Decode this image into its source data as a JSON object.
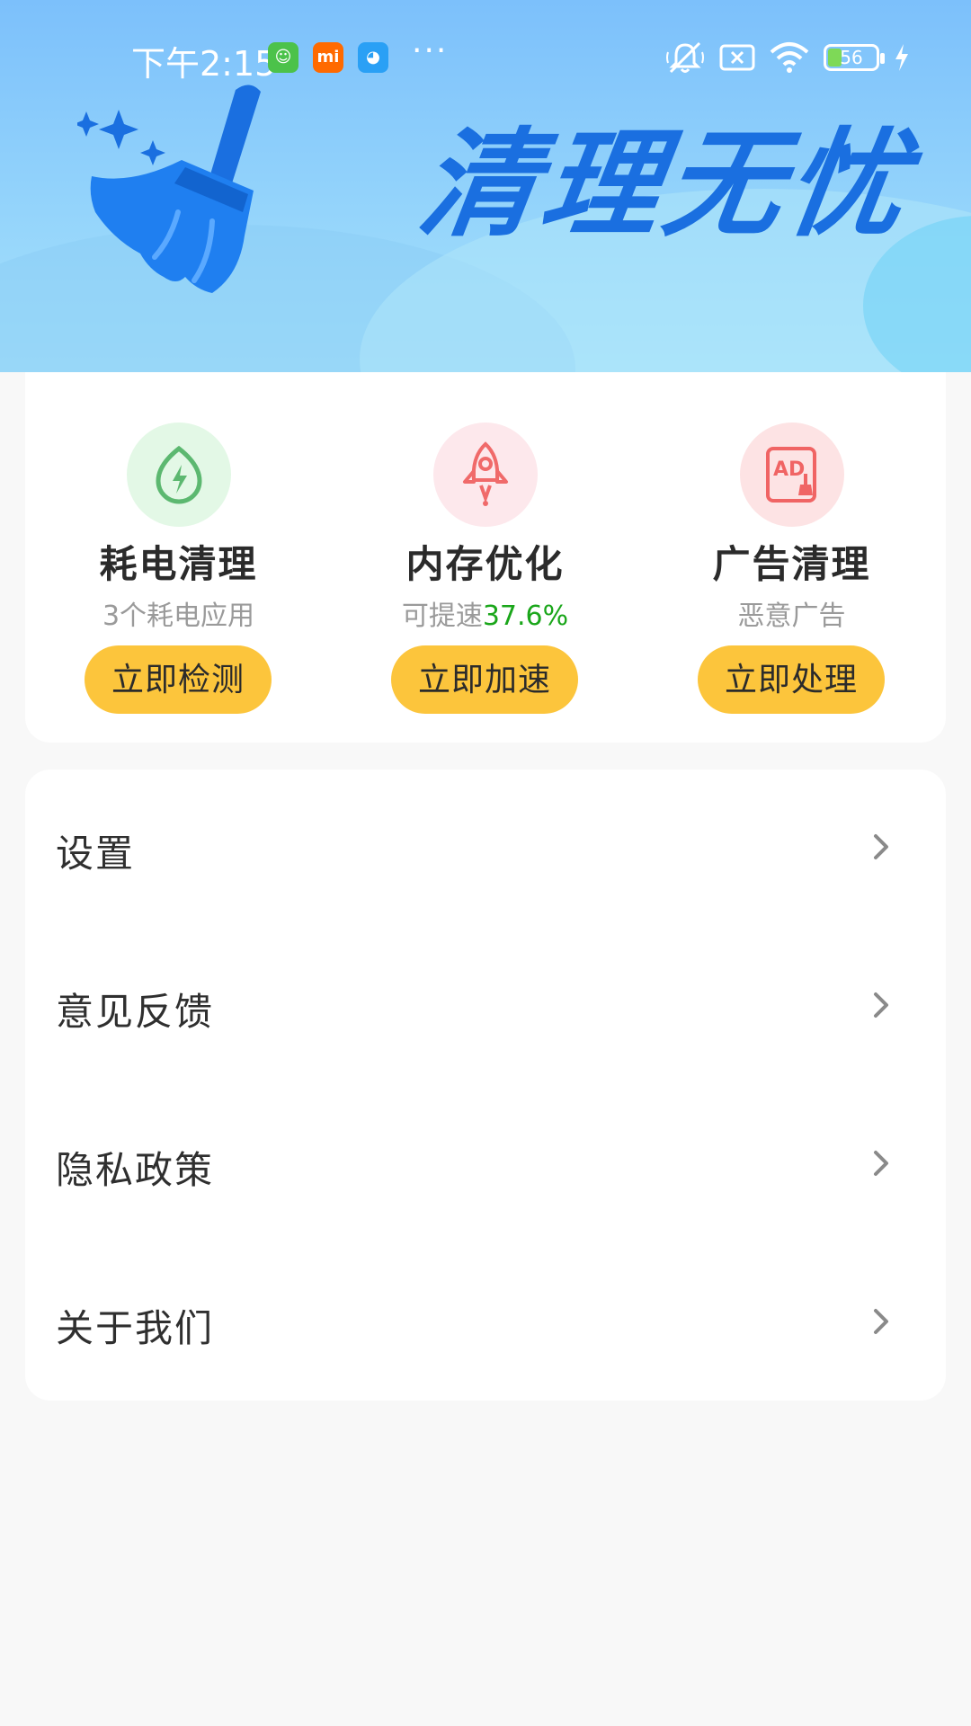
{
  "status_bar": {
    "time": "下午2:15",
    "apps": [
      {
        "icon": "green-app-icon",
        "color": "#4cc24a",
        "glyph": "☺"
      },
      {
        "icon": "mi-app-icon",
        "color": "#ff6a00",
        "glyph": "mi"
      },
      {
        "icon": "blue-app-icon",
        "color": "#2aa0f5",
        "glyph": "◕"
      }
    ],
    "more": "···",
    "battery_level": "56",
    "battery_fraction": 0.56
  },
  "banner": {
    "title": "清理无忧",
    "accent_color": "#1a6fe0"
  },
  "features": [
    {
      "icon": "battery-leaf-icon",
      "icon_bg": "#e3f8e6",
      "icon_color": "#5cb870",
      "title": "耗电清理",
      "subtitle": "3个耗电应用",
      "highlight": "",
      "button": "立即检测"
    },
    {
      "icon": "rocket-icon",
      "icon_bg": "#fde8ec",
      "icon_color": "#f06a6a",
      "title": "内存优化",
      "subtitle": "可提速",
      "highlight": "37.6%",
      "button": "立即加速"
    },
    {
      "icon": "ad-clean-icon",
      "icon_bg": "#fde3e4",
      "icon_color": "#f06464",
      "title": "广告清理",
      "subtitle": "恶意广告",
      "highlight": "",
      "button": "立即处理"
    }
  ],
  "menu": {
    "items": [
      {
        "label": "设置"
      },
      {
        "label": "意见反馈"
      },
      {
        "label": "隐私政策"
      },
      {
        "label": "关于我们"
      }
    ]
  },
  "colors": {
    "button_yellow": "#fcc53c",
    "highlight_green": "#1aa61a",
    "page_bg": "#f8f8f8"
  }
}
